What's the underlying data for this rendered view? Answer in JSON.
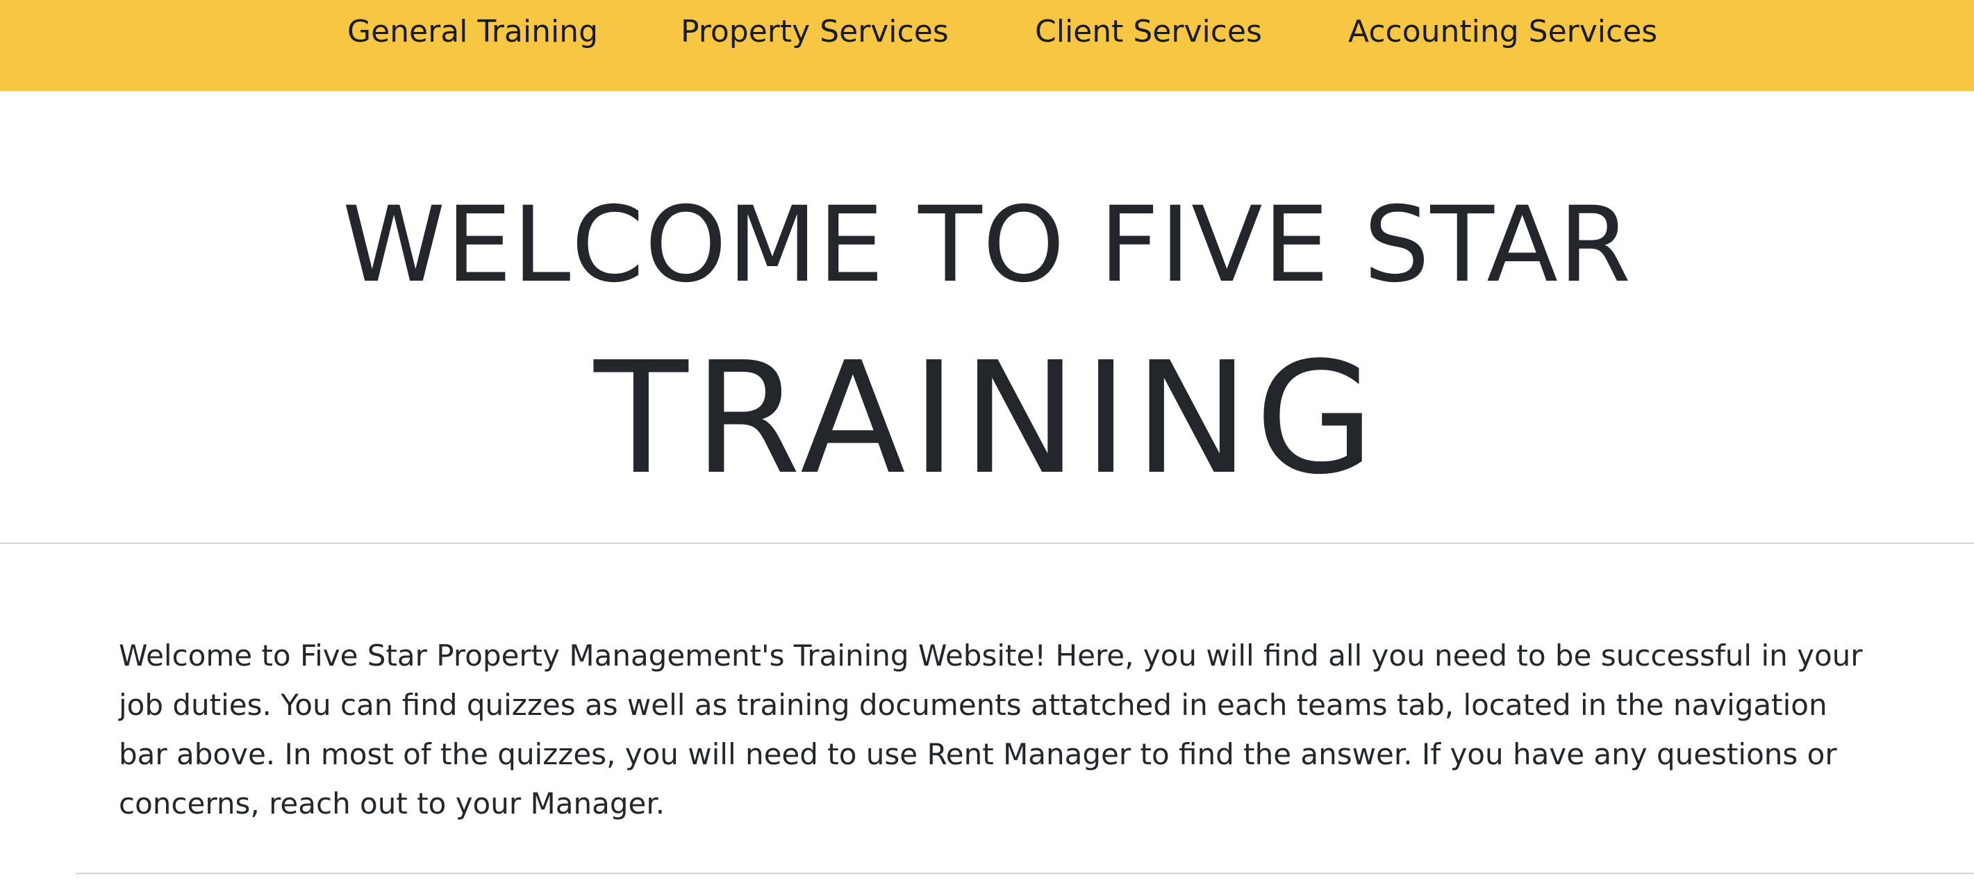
{
  "nav": {
    "items": [
      {
        "label": "General Training"
      },
      {
        "label": "Property Services"
      },
      {
        "label": "Client Services"
      },
      {
        "label": "Accounting Services"
      }
    ]
  },
  "hero": {
    "line1": "WELCOME TO FIVE STAR",
    "line2": "TRAINING"
  },
  "intro": {
    "text": "Welcome to Five Star Property Management's Training Website! Here, you will find all you need to be successful in your job duties. You can find quizzes as well as training documents attatched in each teams tab, located in the navigation bar above. In most of the quizzes, you will need to use Rent Manager to find the answer. If you have any questions or concerns, reach out to your Manager."
  },
  "colors": {
    "navbar_bg": "#f7c744",
    "text": "#23272b",
    "divider": "#d3d3d3"
  }
}
